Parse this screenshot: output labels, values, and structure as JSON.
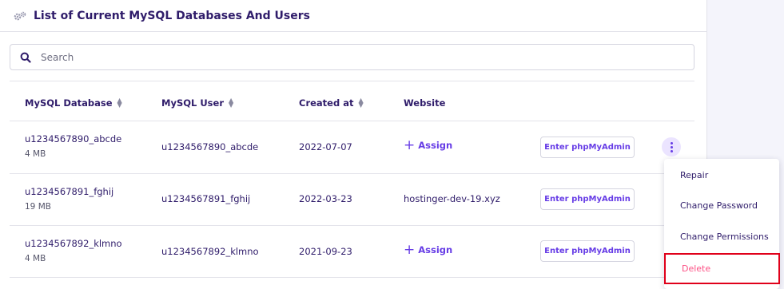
{
  "header": {
    "title": "List of Current MySQL Databases And Users",
    "icon": "gears-icon"
  },
  "search": {
    "placeholder": "Search",
    "value": ""
  },
  "table": {
    "columns": [
      "MySQL Database",
      "MySQL User",
      "Created at",
      "Website"
    ],
    "rows": [
      {
        "database": "u1234567890_abcde",
        "size": "4 MB",
        "user": "u1234567890_abcde",
        "created": "2022-07-07",
        "website": "",
        "assign_label": "Assign",
        "pma_label": "Enter phpMyAdmin"
      },
      {
        "database": "u1234567891_fghij",
        "size": "19 MB",
        "user": "u1234567891_fghij",
        "created": "2022-03-23",
        "website": "hostinger-dev-19.xyz",
        "assign_label": "",
        "pma_label": "Enter phpMyAdmin"
      },
      {
        "database": "u1234567892_klmno",
        "size": "4 MB",
        "user": "u1234567892_klmno",
        "created": "2021-09-23",
        "website": "",
        "assign_label": "Assign",
        "pma_label": "Enter phpMyAdmin"
      }
    ]
  },
  "menu": {
    "items": [
      "Repair",
      "Change Password",
      "Change Permissions",
      "Delete"
    ]
  },
  "colors": {
    "accent": "#673de6",
    "text": "#2f1c6a",
    "delete": "#fc5185",
    "highlight_border": "#e0001a"
  }
}
